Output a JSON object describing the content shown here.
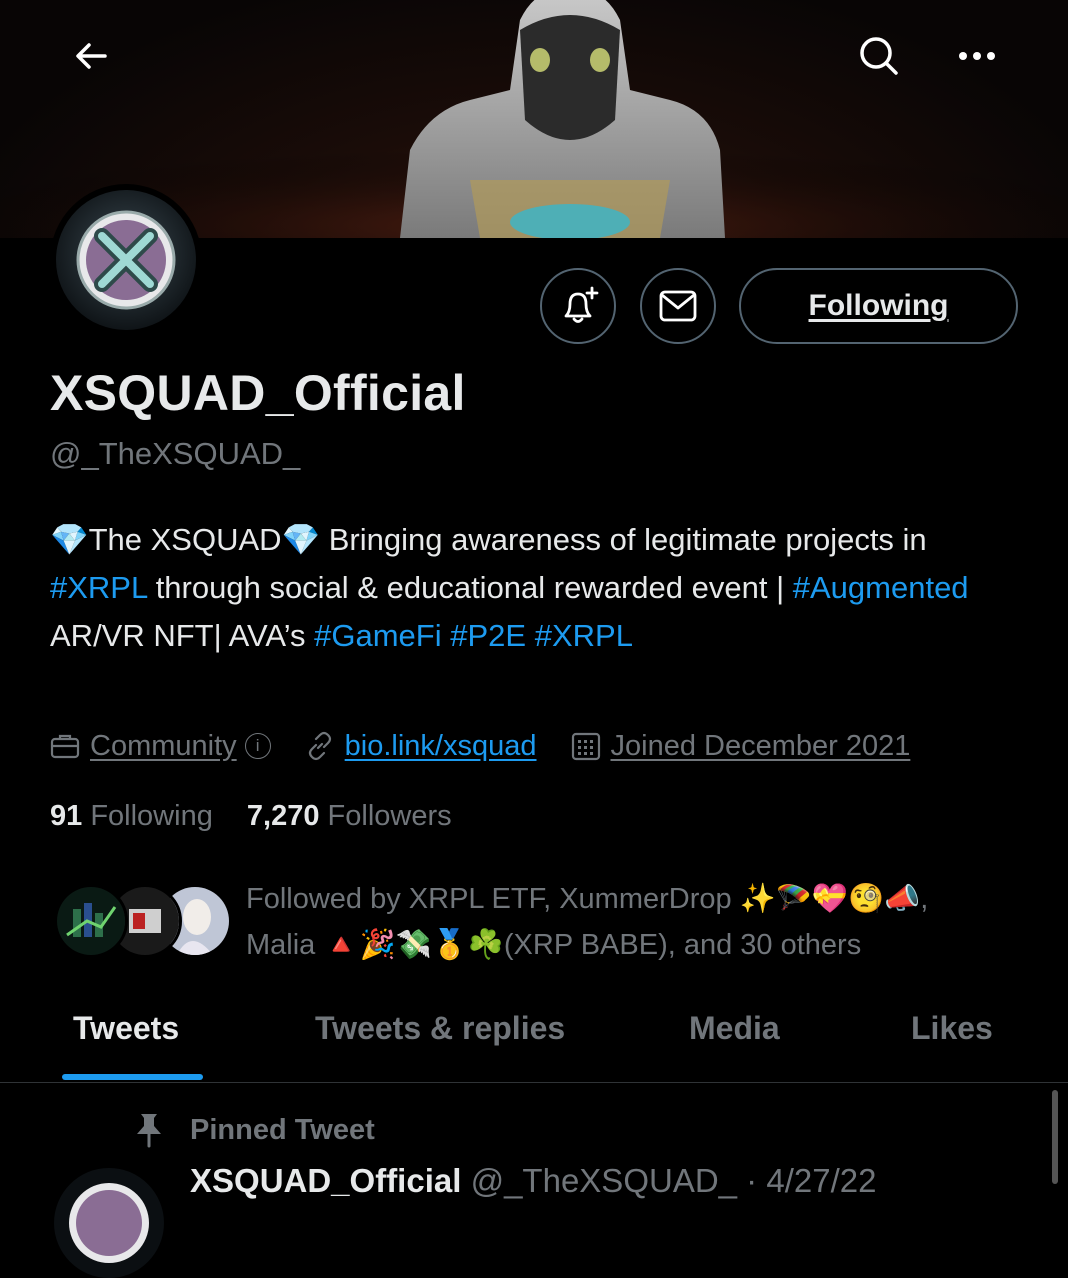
{
  "profile": {
    "display_name": "XSQUAD_Official",
    "handle": "@_TheXSQUAD_",
    "bio": {
      "segments": [
        {
          "text": "💎The XSQUAD💎 Bringing awareness of legitimate projects in ",
          "hashtag": false
        },
        {
          "text": "#XRPL",
          "hashtag": true
        },
        {
          "text": " through social & educational rewarded event | ",
          "hashtag": false
        },
        {
          "text": "#Augmented",
          "hashtag": true
        },
        {
          "text": " AR/VR NFT| AVA’s ",
          "hashtag": false
        },
        {
          "text": "#GameFi",
          "hashtag": true
        },
        {
          "text": " ",
          "hashtag": false
        },
        {
          "text": "#P2E",
          "hashtag": true
        },
        {
          "text": " ",
          "hashtag": false
        },
        {
          "text": "#XRPL",
          "hashtag": true
        }
      ]
    },
    "category": "Community",
    "info_glyph": "i",
    "website": "bio.link/xsquad",
    "joined": "Joined December 2021",
    "following_count": "91",
    "following_label": "Following",
    "followers_count": "7,270",
    "followers_label": "Followers",
    "followed_by_line1": "Followed by XRPL ETF, XummerDrop ✨🪂💝🧐📣,",
    "followed_by_line2": "Malia 🔺🎉💸🥇☘️(XRP BABE), and 30 others"
  },
  "actions": {
    "following_button": "Following"
  },
  "tabs": [
    {
      "label": "Tweets",
      "active": true
    },
    {
      "label": "Tweets & replies",
      "active": false
    },
    {
      "label": "Media",
      "active": false
    },
    {
      "label": "Likes",
      "active": false
    }
  ],
  "pinned": {
    "label": "Pinned Tweet",
    "author_name": "XSQUAD_Official",
    "author_handle": "@_TheXSQUAD_",
    "separator": " · ",
    "date": "4/27/22"
  },
  "icons": {
    "back": "arrow-left-icon",
    "search": "search-icon",
    "more": "more-horizontal-icon",
    "notify": "bell-plus-icon",
    "message": "envelope-icon",
    "category": "briefcase-icon",
    "website": "link-icon",
    "joined": "calendar-icon",
    "pin": "pin-icon"
  },
  "colors": {
    "background": "#000000",
    "text": "#e7e9ea",
    "muted": "#71767b",
    "accent": "#1d9bf0",
    "border": "#536471"
  }
}
